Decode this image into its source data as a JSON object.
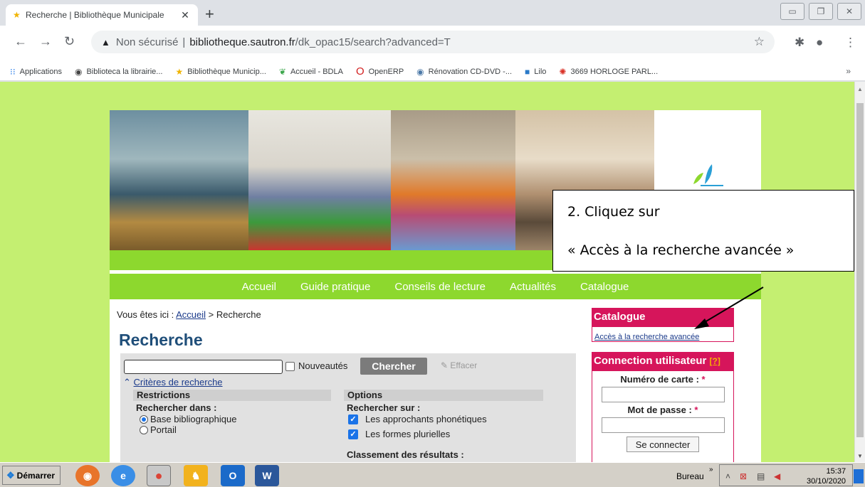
{
  "browser": {
    "tab": {
      "title": "Recherche | Bibliothèque Municipale",
      "favicon": "star-icon",
      "close": "✕"
    },
    "new_tab": "+",
    "window_controls": [
      "minimize-icon",
      "restore-icon",
      "close-icon"
    ],
    "address": {
      "security_label": "Non sécurisé",
      "separator": "|",
      "host": "bibliotheque.sautron.fr",
      "path": "/dk_opac15/search?advanced=T"
    },
    "bookmarks": [
      {
        "label": "Applications",
        "icon": "apps-grid-icon"
      },
      {
        "label": "Biblioteca la librairie...",
        "icon": "globe-icon"
      },
      {
        "label": "Bibliothèque Municip...",
        "icon": "star-icon"
      },
      {
        "label": "Accueil - BDLA",
        "icon": "leaf-icon"
      },
      {
        "label": "OpenERP",
        "icon": "opera-icon"
      },
      {
        "label": "Rénovation CD-DVD -...",
        "icon": "disc-icon"
      },
      {
        "label": "Lilo",
        "icon": "lilo-icon"
      },
      {
        "label": "3669 HORLOGE PARL...",
        "icon": "clock-icon"
      }
    ],
    "bookmarks_more": "»"
  },
  "site": {
    "menu": [
      "Accueil",
      "Guide pratique",
      "Conseils de lecture",
      "Actualités",
      "Catalogue"
    ],
    "breadcrumb": {
      "prefix": "Vous êtes ici :",
      "home": "Accueil",
      "current": "> Recherche"
    },
    "title": "Recherche",
    "search": {
      "new_label": "Nouveautés",
      "search_button": "Chercher",
      "clear_button": "Effacer",
      "criteria_toggle": "Critères de recherche",
      "restrictions_title": "Restrictions",
      "search_in_label": "Rechercher dans :",
      "search_in_options": [
        {
          "label": "Base bibliographique",
          "checked": true
        },
        {
          "label": "Portail",
          "checked": false
        }
      ],
      "options_title": "Options",
      "search_on_label": "Rechercher sur :",
      "search_on_options": [
        {
          "label": "Les approchants phonétiques",
          "checked": true
        },
        {
          "label": "Les formes plurielles",
          "checked": true
        }
      ],
      "sort_label": "Classement des résultats :"
    },
    "sidebar": {
      "catalogue_title": "Catalogue",
      "advanced_link": "Accès à la recherche avancée",
      "login_title": "Connection utilisateur",
      "login_help": "[?]",
      "card_label": "Numéro de carte :",
      "password_label": "Mot de passe :",
      "required_mark": "*",
      "login_button": "Se connecter"
    }
  },
  "annotation": {
    "line1": "2. Cliquez sur",
    "line2": "« Accès à la recherche avancée »"
  },
  "taskbar": {
    "start_label": "Démarrer",
    "apps": [
      "firefox-icon",
      "internet-explorer-icon",
      "chrome-icon",
      "media-icon",
      "outlook-icon",
      "word-icon"
    ],
    "desktop_label": "Bureau",
    "time": "15:37",
    "date": "30/10/2020"
  },
  "colors": {
    "page_bg": "#c4ef71",
    "nav_green": "#8dd82e",
    "accent_pink": "#d6155b",
    "title_blue": "#1f4e79"
  }
}
